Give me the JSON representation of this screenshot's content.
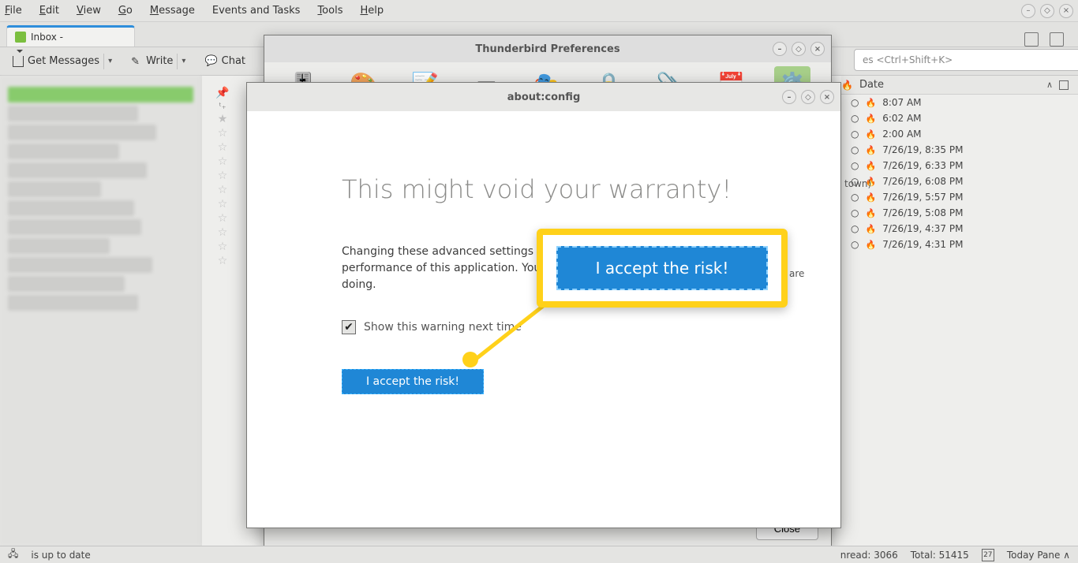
{
  "menubar": {
    "file": "File",
    "edit": "Edit",
    "view": "View",
    "go": "Go",
    "message": "Message",
    "events": "Events and Tasks",
    "tools": "Tools",
    "help": "Help"
  },
  "tab": {
    "label": "Inbox -"
  },
  "toolbar": {
    "get": "Get Messages",
    "write": "Write",
    "chat": "Chat"
  },
  "search": {
    "placeholder": "es <Ctrl+Shift+K>"
  },
  "datecol": {
    "header": "Date"
  },
  "messages": [
    {
      "date": "8:07 AM"
    },
    {
      "date": "6:02 AM"
    },
    {
      "date": "2:00 AM"
    },
    {
      "date": "7/26/19, 8:35 PM"
    },
    {
      "date": "7/26/19, 6:33 PM"
    },
    {
      "date": "7/26/19, 6:08 PM"
    },
    {
      "date": "7/26/19, 5:57 PM"
    },
    {
      "date": "7/26/19, 5:08 PM"
    },
    {
      "date": "7/26/19, 4:37 PM"
    },
    {
      "date": "7/26/19, 4:31 PM"
    }
  ],
  "extra_subject": "town)",
  "pref": {
    "title": "Thunderbird Preferences",
    "close": "Close"
  },
  "config": {
    "title": "about:config",
    "heading": "This might void your warranty!",
    "para_a": "Changing these advanced settings ca",
    "para_b": "performance of this application. You s",
    "para_c": "doing.",
    "para_tail": "are",
    "checkbox": "Show this warning next time",
    "accept": "I accept the risk!"
  },
  "callout": {
    "accept": "I accept the risk!"
  },
  "status": {
    "uptodate": "is up to date",
    "unread": "nread: 3066",
    "total": "Total: 51415",
    "today": "Today Pane",
    "cal": "27"
  }
}
